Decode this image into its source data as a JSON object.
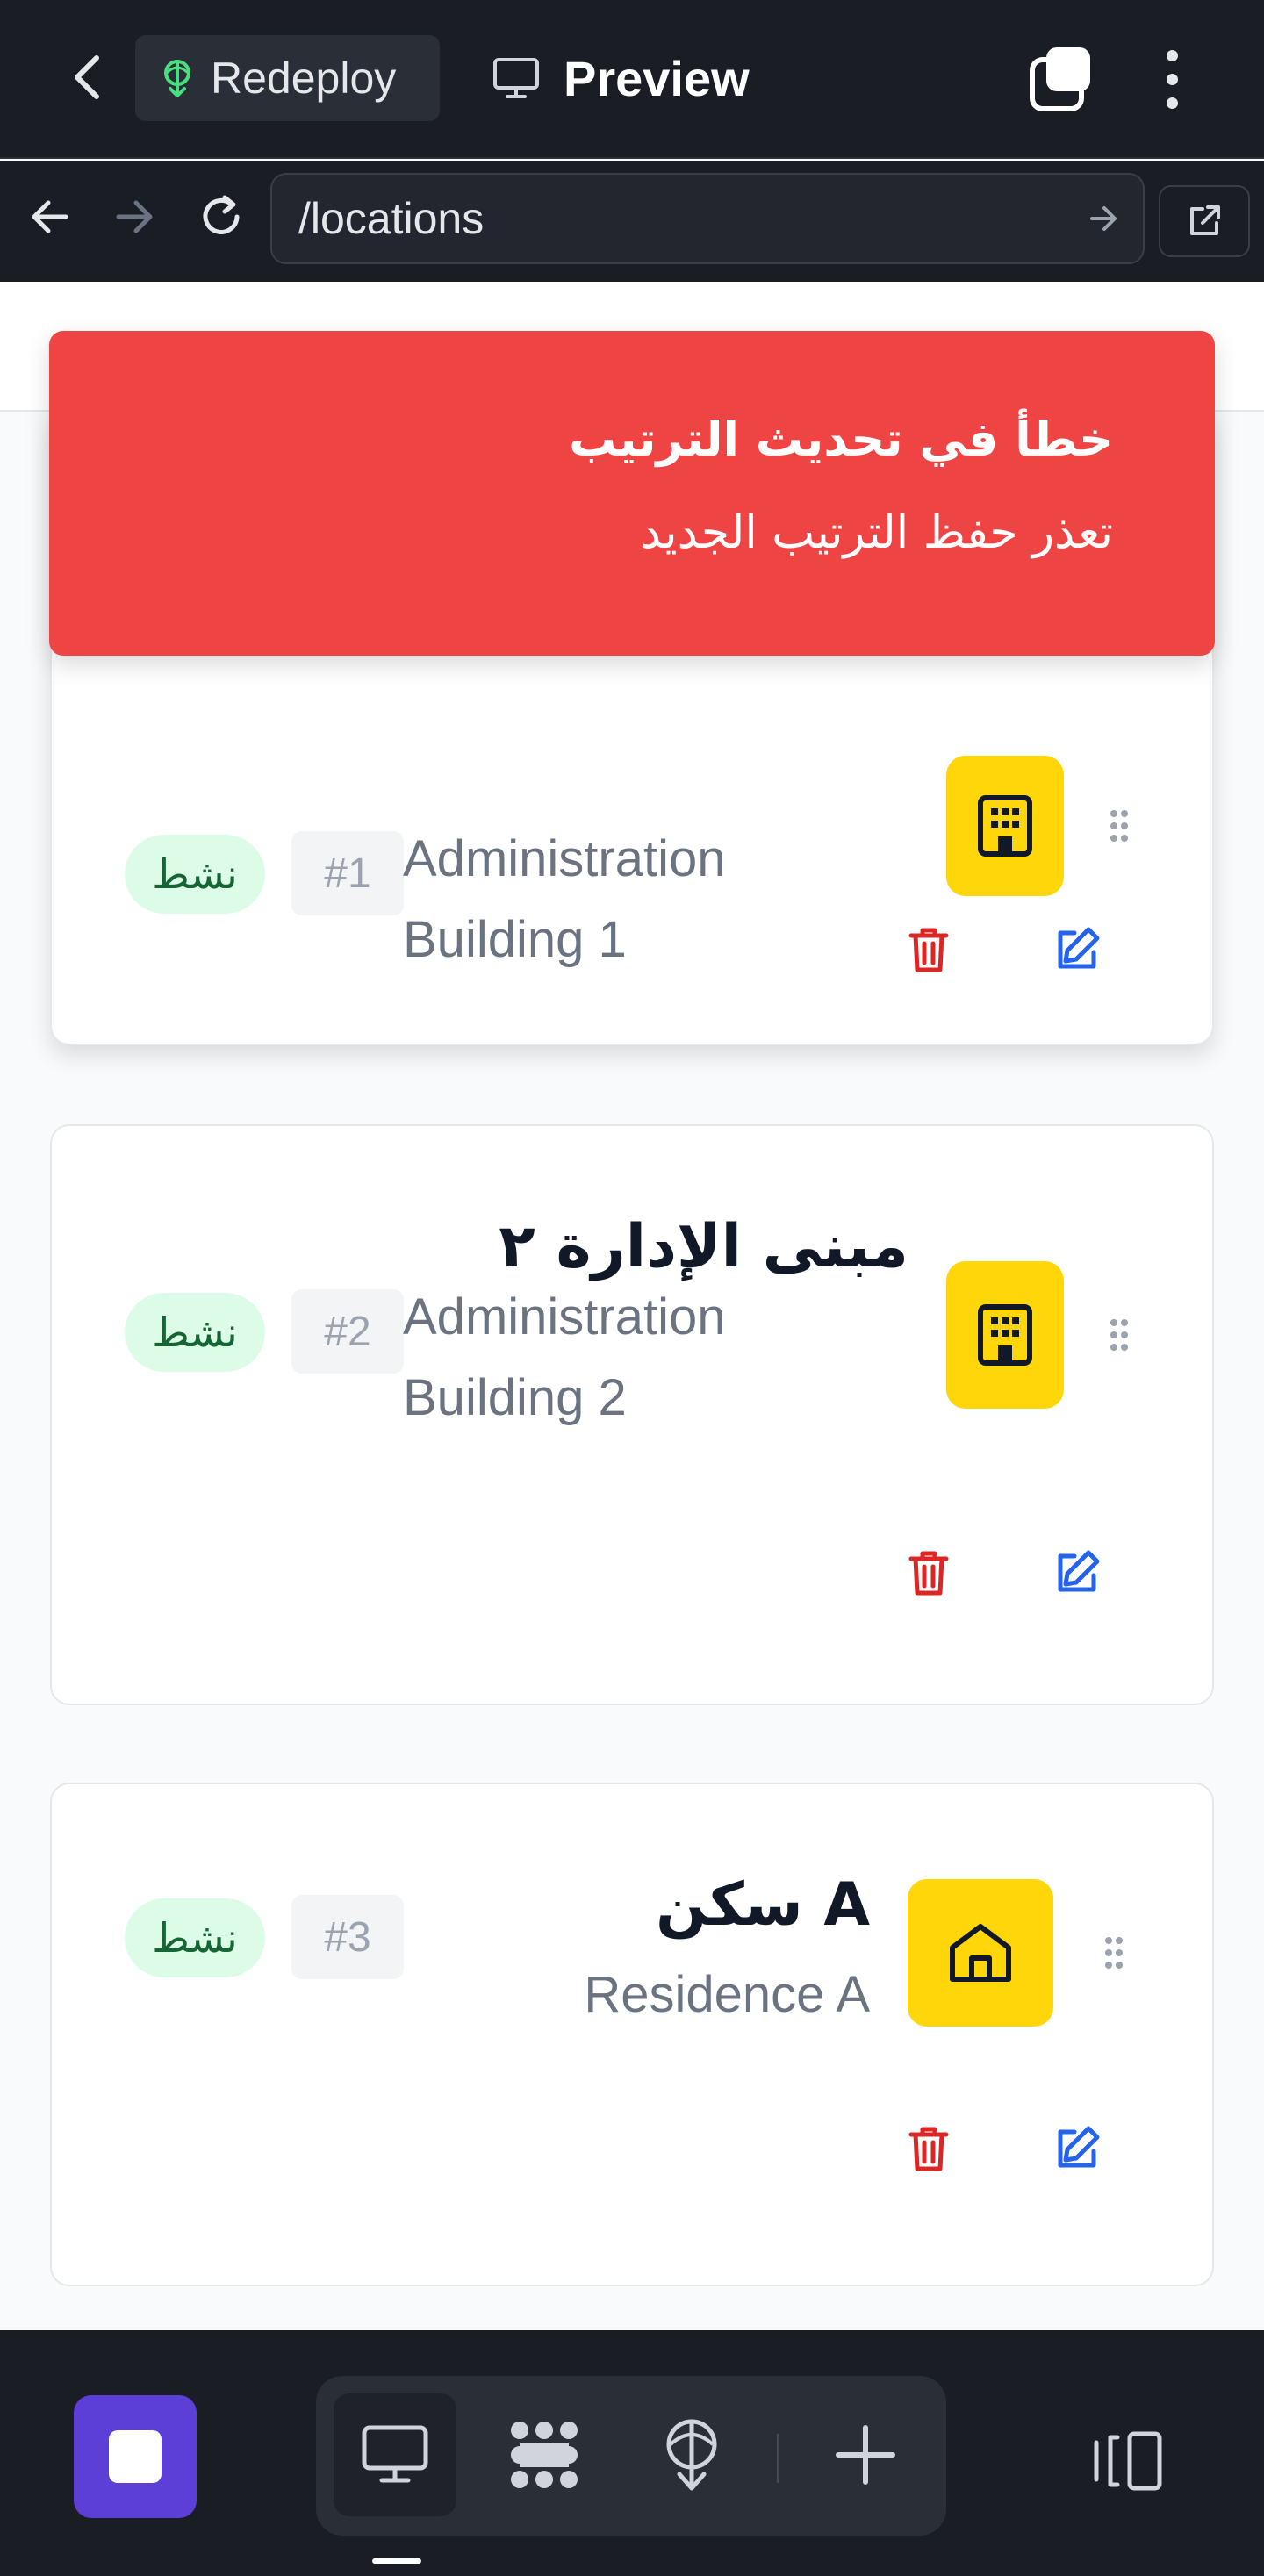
{
  "appbar": {
    "redeploy_label": "Redeploy",
    "preview_label": "Preview"
  },
  "browser": {
    "url": "/locations"
  },
  "toast": {
    "title": "خطأ في تحديث الترتيب",
    "message": "تعذر حفظ الترتيب الجديد",
    "color": "#ef4444"
  },
  "locations": [
    {
      "name_ar": "",
      "name_en": "Administration Building 1",
      "order": "#1",
      "status": "نشط",
      "icon": "building-icon"
    },
    {
      "name_ar": "مبنى الإدارة ٢",
      "name_en": "Administration Building 2",
      "order": "#2",
      "status": "نشط",
      "icon": "building-icon"
    },
    {
      "name_ar": "سكن A",
      "name_en": "Residence A",
      "order": "#3",
      "status": "نشط",
      "icon": "home-icon"
    }
  ],
  "colors": {
    "accent_yellow": "#ffd60a",
    "status_bg": "#dcfce7",
    "status_text": "#166534",
    "delete": "#dc2626",
    "edit": "#2563eb",
    "dock_primary": "#5b3fd6"
  }
}
